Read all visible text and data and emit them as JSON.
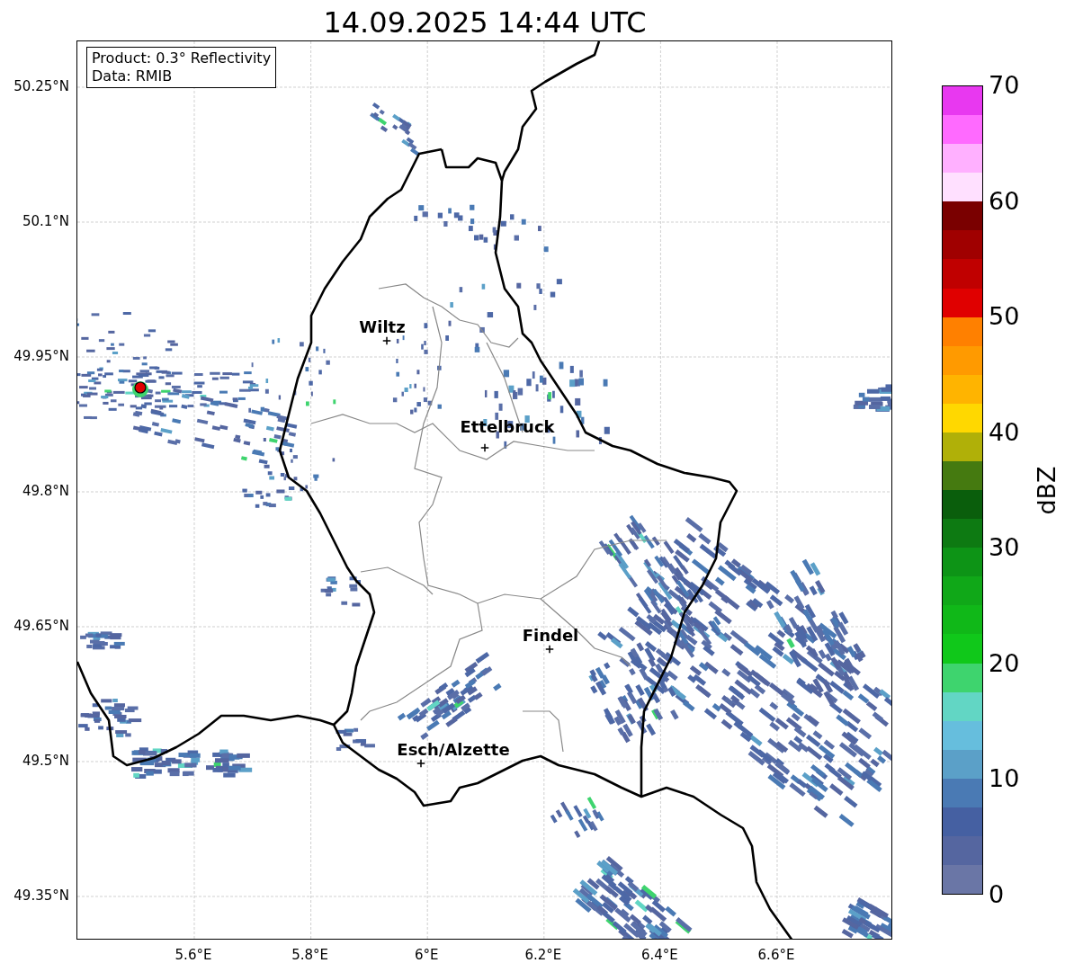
{
  "title": "14.09.2025 14:44 UTC",
  "info_box": {
    "lines": [
      "Product: 0.3° Reflectivity",
      "Data: RMIB"
    ]
  },
  "map": {
    "places": [
      {
        "name": "Wiltz"
      },
      {
        "name": "Ettelbruck"
      },
      {
        "name": "Findel"
      },
      {
        "name": "Esch/Alzette"
      }
    ],
    "lat_labels": [
      "50.25°N",
      "50.1°N",
      "49.95°N",
      "49.8°N",
      "49.65°N",
      "49.5°N",
      "49.35°N"
    ],
    "lon_labels": [
      "5.6°E",
      "5.8°E",
      "6°E",
      "6.2°E",
      "6.4°E",
      "6.6°E"
    ]
  },
  "colorbar": {
    "label": "dBZ",
    "ticks": [
      "70",
      "60",
      "50",
      "40",
      "30",
      "20",
      "10",
      "0"
    ],
    "segments": [
      {
        "color": "#e838f0"
      },
      {
        "color": "#ff6aff"
      },
      {
        "color": "#ffb0ff"
      },
      {
        "color": "#ffe0ff"
      },
      {
        "color": "#7a0000"
      },
      {
        "color": "#a00000"
      },
      {
        "color": "#c00000"
      },
      {
        "color": "#e00000"
      },
      {
        "color": "#ff8000"
      },
      {
        "color": "#ff9a00"
      },
      {
        "color": "#ffb400"
      },
      {
        "color": "#ffd800"
      },
      {
        "color": "#b0b008"
      },
      {
        "color": "#457a10"
      },
      {
        "color": "#0a5e0c"
      },
      {
        "color": "#0d7a12"
      },
      {
        "color": "#0d9416"
      },
      {
        "color": "#10a818"
      },
      {
        "color": "#10b818"
      },
      {
        "color": "#10c81a"
      },
      {
        "color": "#3ed46e"
      },
      {
        "color": "#62d6c4"
      },
      {
        "color": "#66bedd"
      },
      {
        "color": "#5ba0c8"
      },
      {
        "color": "#4a7ab4"
      },
      {
        "color": "#4560a2"
      },
      {
        "color": "#5566a0"
      },
      {
        "color": "#6a76a6"
      }
    ]
  }
}
